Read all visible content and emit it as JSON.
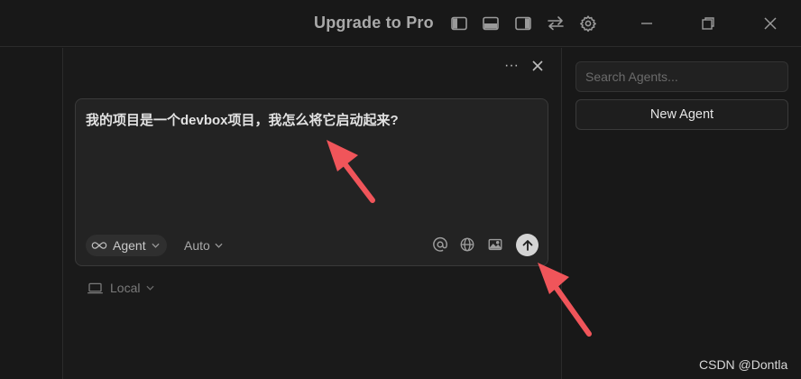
{
  "titlebar": {
    "upgrade_label": "Upgrade to Pro",
    "icons": [
      "toggle-left-sidebar-icon",
      "toggle-bottom-panel-icon",
      "toggle-right-sidebar-icon",
      "swap-icon",
      "gear-icon",
      "minimize-icon",
      "restore-icon",
      "close-icon"
    ]
  },
  "panel": {
    "more_label": "···",
    "composer": {
      "prompt": "我的项目是一个devbox项目，我怎么将它启动起来?",
      "mode_label": "Agent",
      "model_label": "Auto"
    },
    "location_label": "Local"
  },
  "sidebar": {
    "search_placeholder": "Search Agents...",
    "new_agent_label": "New Agent"
  },
  "watermark": "CSDN @Dontla",
  "colors": {
    "background": "#181818",
    "panel": "#1a1a1a",
    "composer": "#232323",
    "annotation_arrow": "#f0555a"
  }
}
